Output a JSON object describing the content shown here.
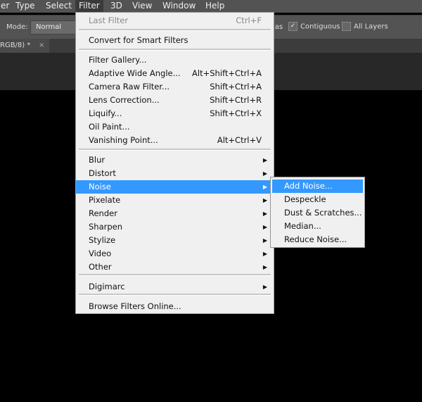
{
  "menubar": [
    "er",
    "Type",
    "Select",
    "Filter",
    "3D",
    "View",
    "Window",
    "Help"
  ],
  "options": {
    "mode_label": "Mode:",
    "mode_value": "Normal",
    "antialias_partial": "ias",
    "contiguous": "Contiguous",
    "contiguous_checked": true,
    "all_layers": "All Layers",
    "all_layers_checked": false
  },
  "tab": {
    "title": "RGB/8) *",
    "close": "×"
  },
  "filter_menu": [
    {
      "label": "Last Filter",
      "shortcut": "Ctrl+F",
      "disabled": true
    },
    {
      "label": "Convert for Smart Filters"
    },
    {
      "label": "Filter Gallery..."
    },
    {
      "label": "Adaptive Wide Angle...",
      "shortcut": "Alt+Shift+Ctrl+A"
    },
    {
      "label": "Camera Raw Filter...",
      "shortcut": "Shift+Ctrl+A"
    },
    {
      "label": "Lens Correction...",
      "shortcut": "Shift+Ctrl+R"
    },
    {
      "label": "Liquify...",
      "shortcut": "Shift+Ctrl+X"
    },
    {
      "label": "Oil Paint..."
    },
    {
      "label": "Vanishing Point...",
      "shortcut": "Alt+Ctrl+V"
    },
    {
      "label": "Blur"
    },
    {
      "label": "Distort"
    },
    {
      "label": "Noise"
    },
    {
      "label": "Pixelate"
    },
    {
      "label": "Render"
    },
    {
      "label": "Sharpen"
    },
    {
      "label": "Stylize"
    },
    {
      "label": "Video"
    },
    {
      "label": "Other"
    },
    {
      "label": "Digimarc"
    },
    {
      "label": "Browse Filters Online..."
    }
  ],
  "arrow": "▶",
  "noise_submenu": [
    "Add Noise...",
    "Despeckle",
    "Dust & Scratches...",
    "Median...",
    "Reduce Noise..."
  ],
  "colors": {
    "highlight": "#3399ff",
    "menu_bg": "#f0f0f0",
    "chrome": "#535353"
  }
}
